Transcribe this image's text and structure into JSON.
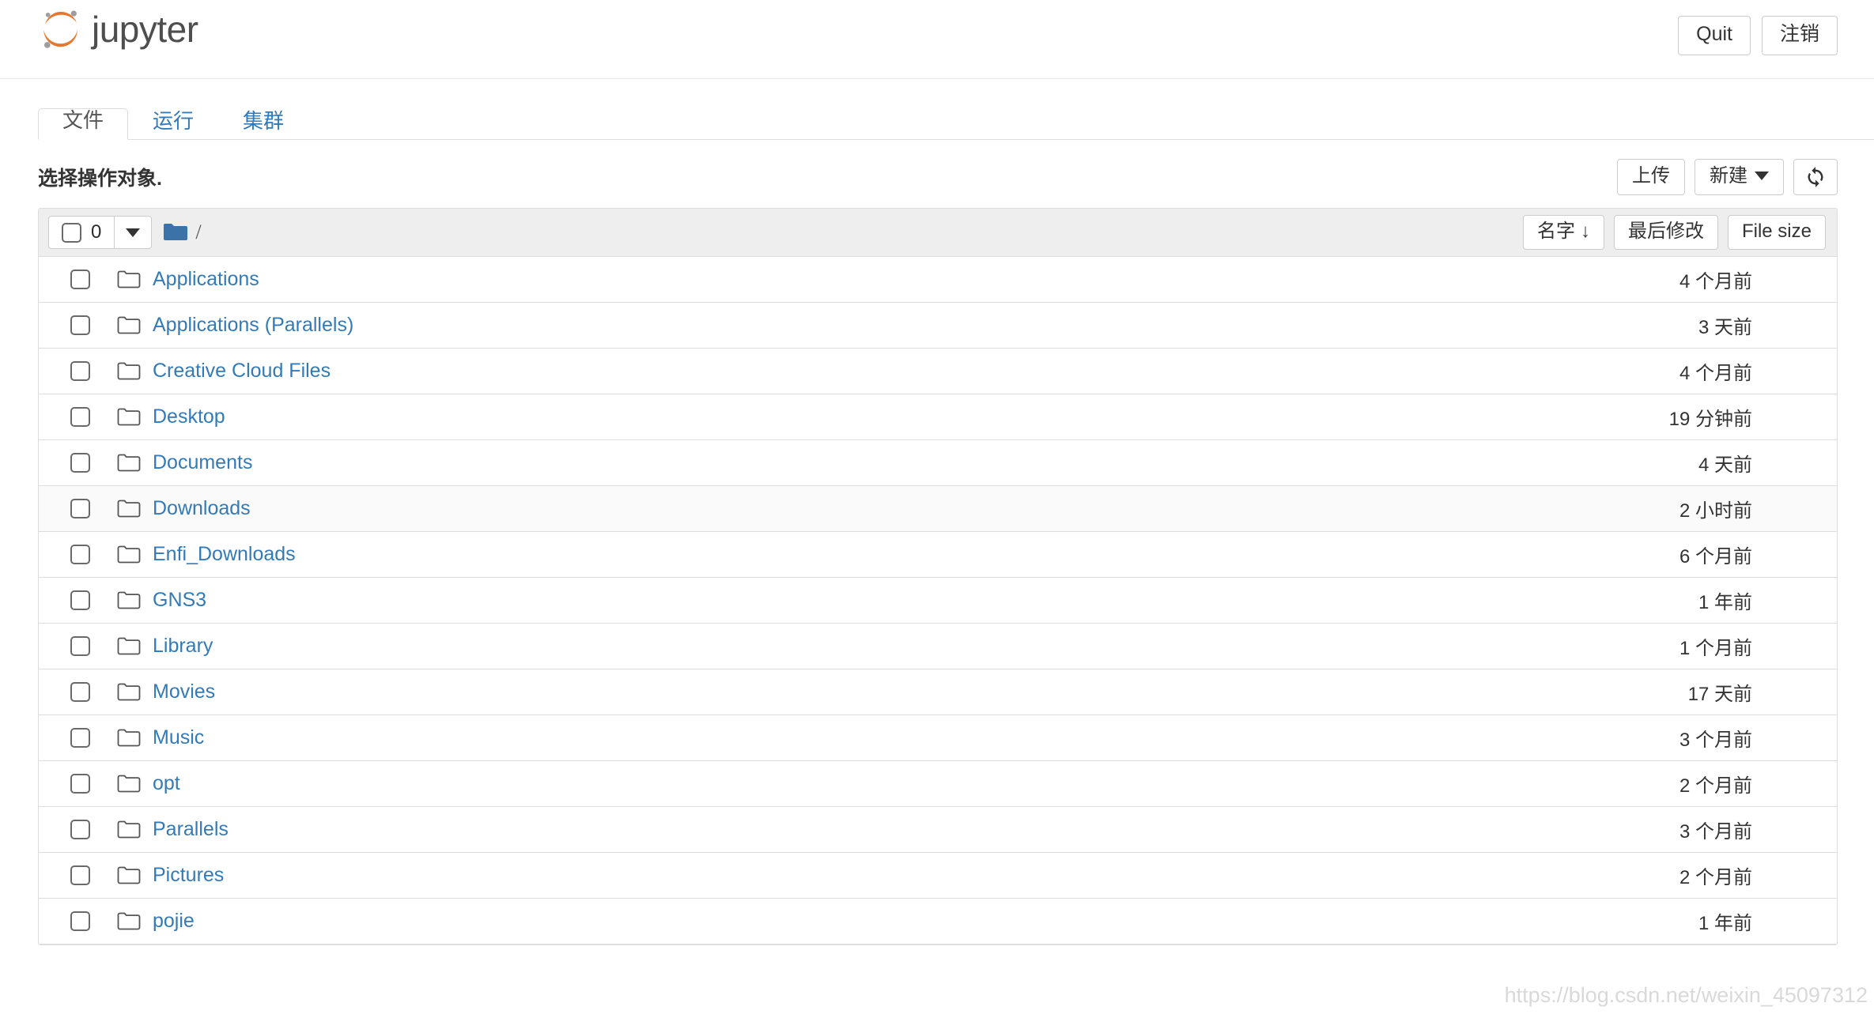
{
  "header": {
    "brand": "jupyter",
    "logo_color": "#e8772e",
    "logo_dot_color": "#9e9e9e",
    "buttons": [
      {
        "label": "Quit",
        "name": "quit-button"
      },
      {
        "label": "注销",
        "name": "logout-button"
      }
    ]
  },
  "tabs": [
    {
      "label": "文件",
      "name": "tab-files",
      "active": true
    },
    {
      "label": "运行",
      "name": "tab-running",
      "active": false
    },
    {
      "label": "集群",
      "name": "tab-clusters",
      "active": false
    }
  ],
  "action_bar": {
    "hint": "选择操作对象.",
    "upload_label": "上传",
    "new_label": "新建",
    "refresh_icon": "refresh-icon"
  },
  "list_header": {
    "selected_count": "0",
    "breadcrumb_path": "/",
    "folder_icon": "folder-filled-icon",
    "sort_name": "名字",
    "sort_name_arrow": "↓",
    "sort_modified": "最后修改",
    "sort_filesize": "File size"
  },
  "colors": {
    "link": "#337ab7",
    "accent": "#e8772e",
    "header_bg": "#eeeeee",
    "border": "#dddddd",
    "row_hover": "#fafafa"
  },
  "rows": [
    {
      "name": "Applications",
      "modified": "4 个月前",
      "icon": "folder-icon",
      "highlight": false
    },
    {
      "name": "Applications (Parallels)",
      "modified": "3 天前",
      "icon": "folder-icon",
      "highlight": false
    },
    {
      "name": "Creative Cloud Files",
      "modified": "4 个月前",
      "icon": "folder-icon",
      "highlight": false
    },
    {
      "name": "Desktop",
      "modified": "19 分钟前",
      "icon": "folder-icon",
      "highlight": false
    },
    {
      "name": "Documents",
      "modified": "4 天前",
      "icon": "folder-icon",
      "highlight": false
    },
    {
      "name": "Downloads",
      "modified": "2 小时前",
      "icon": "folder-icon",
      "highlight": true
    },
    {
      "name": "Enfi_Downloads",
      "modified": "6 个月前",
      "icon": "folder-icon",
      "highlight": false
    },
    {
      "name": "GNS3",
      "modified": "1 年前",
      "icon": "folder-icon",
      "highlight": false
    },
    {
      "name": "Library",
      "modified": "1 个月前",
      "icon": "folder-icon",
      "highlight": false
    },
    {
      "name": "Movies",
      "modified": "17 天前",
      "icon": "folder-icon",
      "highlight": false
    },
    {
      "name": "Music",
      "modified": "3 个月前",
      "icon": "folder-icon",
      "highlight": false
    },
    {
      "name": "opt",
      "modified": "2 个月前",
      "icon": "folder-icon",
      "highlight": false
    },
    {
      "name": "Parallels",
      "modified": "3 个月前",
      "icon": "folder-icon",
      "highlight": false
    },
    {
      "name": "Pictures",
      "modified": "2 个月前",
      "icon": "folder-icon",
      "highlight": false
    },
    {
      "name": "pojie",
      "modified": "1 年前",
      "icon": "folder-icon",
      "highlight": false
    }
  ],
  "watermark": "https://blog.csdn.net/weixin_45097312"
}
